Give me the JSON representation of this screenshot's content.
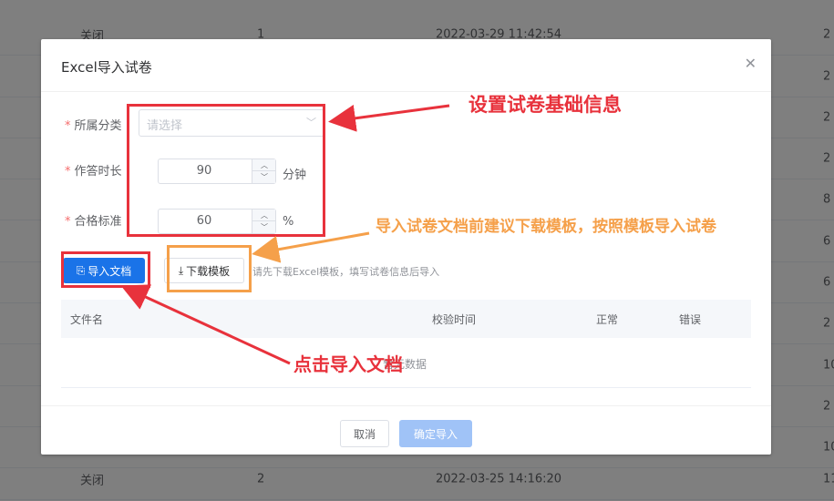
{
  "background_table": {
    "rows": [
      {
        "status": "关闭",
        "count": "1",
        "time": "2022-03-29 11:42:54",
        "extra": "2"
      },
      {
        "status": "",
        "count": "",
        "time": "",
        "extra": "2"
      },
      {
        "status": "",
        "count": "",
        "time": "",
        "extra": "2"
      },
      {
        "status": "",
        "count": "",
        "time": "",
        "extra": "2"
      },
      {
        "status": "",
        "count": "",
        "time": "",
        "extra": "8"
      },
      {
        "status": "",
        "count": "",
        "time": "",
        "extra": "6"
      },
      {
        "status": "",
        "count": "",
        "time": "",
        "extra": "6"
      },
      {
        "status": "",
        "count": "",
        "time": "",
        "extra": "2"
      },
      {
        "status": "",
        "count": "",
        "time": "",
        "extra": "10"
      },
      {
        "status": "",
        "count": "",
        "time": "",
        "extra": "2"
      },
      {
        "status": "",
        "count": "",
        "time": "",
        "extra": "10"
      },
      {
        "status": "关闭",
        "count": "2",
        "time": "2022-03-25 14:16:20",
        "extra": "11"
      }
    ]
  },
  "dialog": {
    "title": "Excel导入试卷",
    "close_icon": "close-icon",
    "form": {
      "category": {
        "label": "所属分类",
        "placeholder": "请选择"
      },
      "duration": {
        "label": "作答时长",
        "value": "90",
        "unit": "分钟"
      },
      "passing": {
        "label": "合格标准",
        "value": "60",
        "unit": "%"
      }
    },
    "import_button": "导入文档",
    "download_button": "下载模板",
    "hint": "请先下载Excel模板，填写试卷信息后导入",
    "table": {
      "columns": [
        "文件名",
        "校验时间",
        "正常",
        "错误"
      ],
      "empty_text": "暂无数据"
    },
    "cancel_button": "取消",
    "confirm_button": "确定导入"
  },
  "annotations": {
    "settings_note": "设置试卷基础信息",
    "template_note": "导入试卷文档前建议下载模板，按照模板导入试卷",
    "import_note": "点击导入文档",
    "red": "#e8323c",
    "orange": "#f5a04a"
  }
}
